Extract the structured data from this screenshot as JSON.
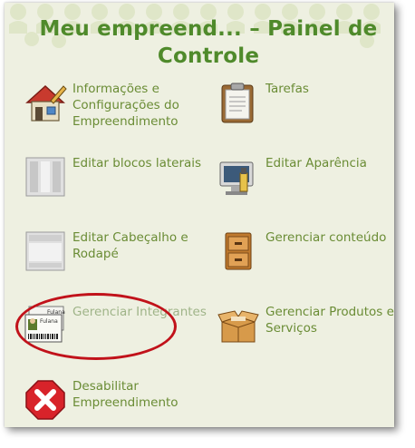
{
  "title": "Meu empreend... – Painel de Controle",
  "items": [
    {
      "label": "Informações e Configurações do Empreendimento",
      "icon": "house-edit-icon"
    },
    {
      "label": "Tarefas",
      "icon": "clipboard-icon"
    },
    {
      "label": "Editar blocos laterais",
      "icon": "side-blocks-icon"
    },
    {
      "label": "Editar Aparência",
      "icon": "monitor-paint-icon"
    },
    {
      "label": "Editar Cabeçalho e Rodapé",
      "icon": "header-footer-icon"
    },
    {
      "label": "Gerenciar conteúdo",
      "icon": "file-cabinet-icon"
    },
    {
      "label": "Gerenciar Integrantes",
      "icon": "id-card-icon",
      "badge_name": "Fulana"
    },
    {
      "label": "Gerenciar Produtos e Serviços",
      "icon": "open-box-icon"
    },
    {
      "label": "Desabilitar Empreendimento",
      "icon": "red-x-icon"
    }
  ],
  "colors": {
    "title": "#4f8a2b",
    "label": "#6a8c35",
    "highlight": "#c1121a",
    "panel": "#eef0e1"
  }
}
